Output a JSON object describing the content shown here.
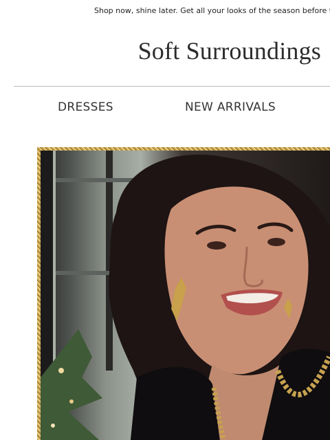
{
  "promo": {
    "text": "Shop now, shine later. Get all your looks of the season before th"
  },
  "header": {
    "logo_text": "Soft Surroundings"
  },
  "nav": {
    "items": [
      {
        "label": "DRESSES"
      },
      {
        "label": "NEW ARRIVALS"
      }
    ]
  },
  "hero": {
    "image_icon": "portrait-photo",
    "accent": "#c8a24a"
  }
}
